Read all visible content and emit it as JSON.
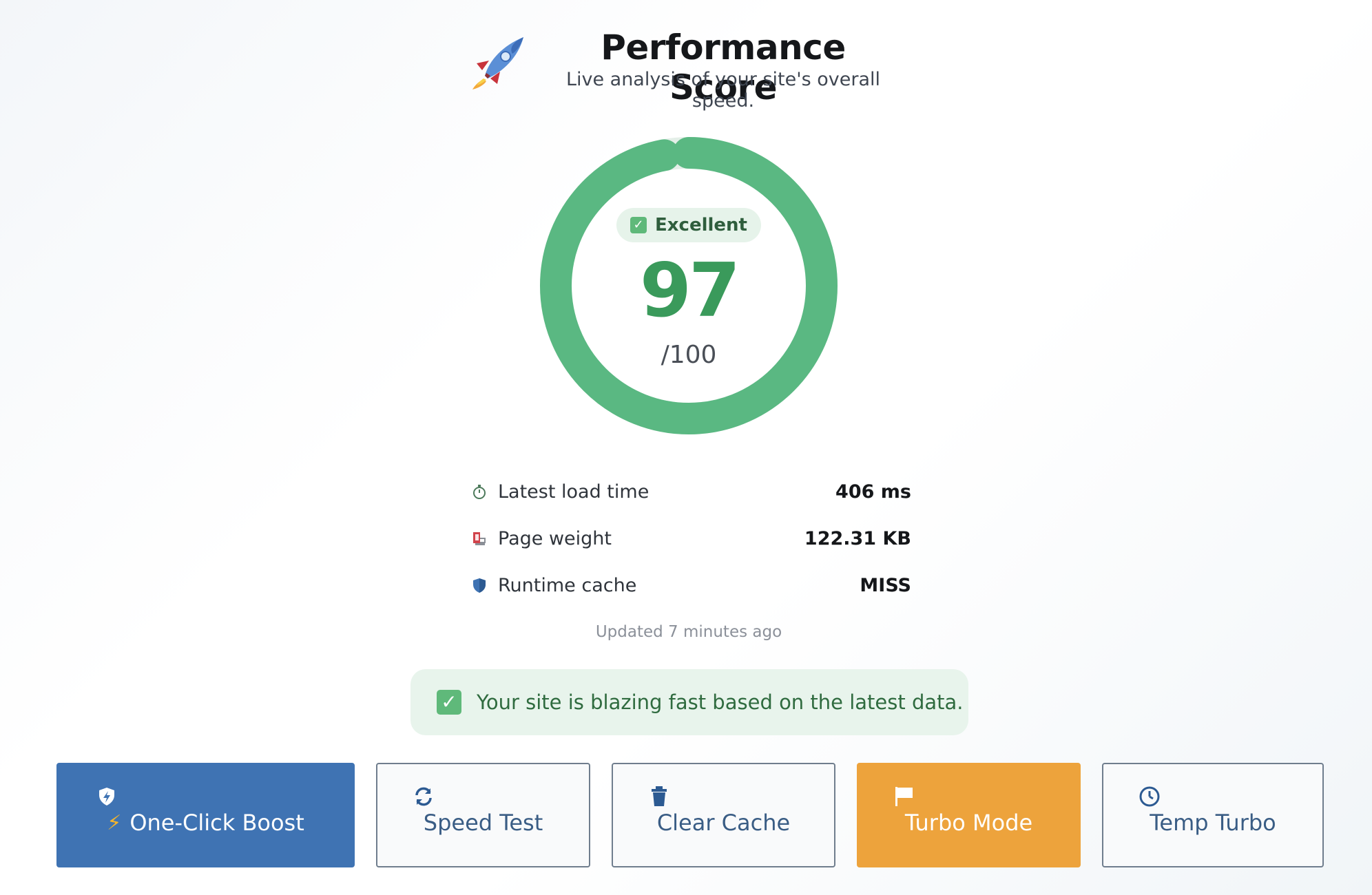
{
  "header": {
    "title": "Performance Score",
    "subtitle": "Live analysis of your site's overall speed."
  },
  "gauge": {
    "status": "Excellent",
    "score": "97",
    "max": "/100",
    "progress_fraction": 0.97,
    "color": "#5ab882"
  },
  "metrics": [
    {
      "icon": "stopwatch-icon",
      "label": "Latest load time",
      "value": "406 ms"
    },
    {
      "icon": "weight-icon",
      "label": "Page weight",
      "value": "122.31 KB"
    },
    {
      "icon": "shield-icon",
      "label": "Runtime cache",
      "value": "MISS"
    }
  ],
  "updated": "Updated 7 minutes ago",
  "alert": {
    "text": "Your site is blazing fast based on the latest data."
  },
  "buttons": [
    {
      "label": "One-Click Boost",
      "icon": "shield-bolt-icon"
    },
    {
      "label": "Speed Test",
      "icon": "refresh-icon"
    },
    {
      "label": "Clear Cache",
      "icon": "trash-icon"
    },
    {
      "label": "Turbo Mode",
      "icon": "flag-icon"
    },
    {
      "label": "Temp Turbo",
      "icon": "clock-icon"
    }
  ],
  "colors": {
    "primary": "#3f73b3",
    "warning": "#eda33c",
    "success": "#5fb97a"
  }
}
